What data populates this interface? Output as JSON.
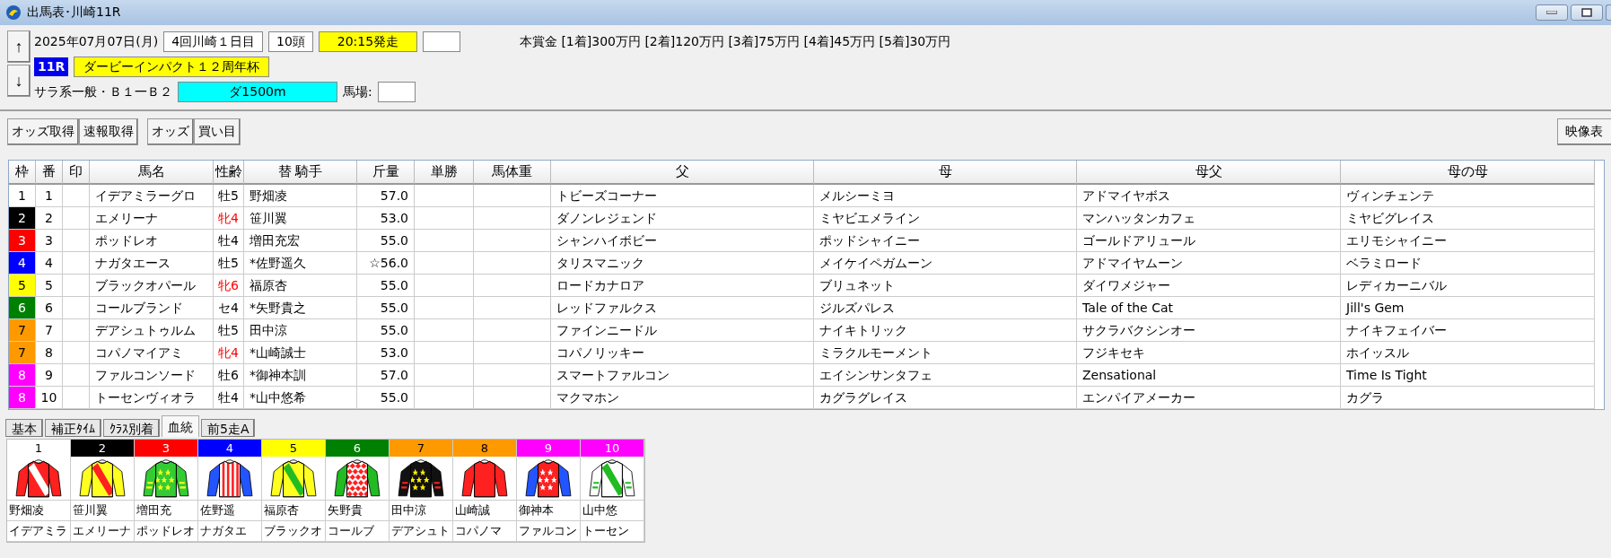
{
  "window": {
    "title": "出馬表･川崎11R"
  },
  "race": {
    "date": "2025年07月07日(月)",
    "meeting": "4回川崎１日目",
    "runners": "10頭",
    "post_time": "20:15発走",
    "race_number": "11R",
    "race_name": "ダービーインパクト１２周年杯",
    "class": "サラ系一般・Ｂ１一Ｂ２",
    "course": "ダ1500m",
    "going_label": "馬場:",
    "prize": "本賞金 [1着]300万円 [2着]120万円 [3着]75万円 [4着]45万円 [5着]30万円"
  },
  "nav_buttons": [
    "↑",
    "↓"
  ],
  "toolbar": [
    "オッズ取得",
    "速報取得",
    "オッズ",
    "買い目"
  ],
  "right_button": "映像表",
  "table": {
    "columns": [
      "枠",
      "番",
      "印",
      "馬名",
      "性齢",
      "替 騎手",
      "斤量",
      "単勝",
      "馬体重",
      "父",
      "母",
      "母父",
      "母の母"
    ],
    "rows": [
      {
        "frame": "1",
        "color": "#ffffff",
        "number": "1",
        "name": "イデアミラーグロ",
        "sex_age": "牡5",
        "filly": false,
        "jockey": "野畑凌",
        "weight": "57.0",
        "sire": "トビーズコーナー",
        "dam": "メルシーミヨ",
        "damsire": "アドマイヤボス",
        "dam_dam": "ヴィンチェンテ"
      },
      {
        "frame": "2",
        "color": "#000000",
        "number": "2",
        "name": "エメリーナ",
        "sex_age": "牝4",
        "filly": true,
        "jockey": "笹川翼",
        "weight": "53.0",
        "sire": "ダノンレジェンド",
        "dam": "ミヤビエメライン",
        "damsire": "マンハッタンカフェ",
        "dam_dam": "ミヤビグレイス"
      },
      {
        "frame": "3",
        "color": "#ff0000",
        "number": "3",
        "name": "ポッドレオ",
        "sex_age": "牡4",
        "filly": false,
        "jockey": "増田充宏",
        "weight": "55.0",
        "sire": "シャンハイボビー",
        "dam": "ポッドシャイニー",
        "damsire": "ゴールドアリュール",
        "dam_dam": "エリモシャイニー"
      },
      {
        "frame": "4",
        "color": "#0000ff",
        "number": "4",
        "name": "ナガタエース",
        "sex_age": "牡5",
        "filly": false,
        "jockey": "*佐野遥久",
        "weight": "☆56.0",
        "sire": "タリスマニック",
        "dam": "メイケイペガムーン",
        "damsire": "アドマイヤムーン",
        "dam_dam": "ベラミロード"
      },
      {
        "frame": "5",
        "color": "#ffff00",
        "number": "5",
        "name": "ブラックオパール",
        "sex_age": "牝6",
        "filly": true,
        "jockey": "福原杏",
        "weight": "55.0",
        "sire": "ロードカナロア",
        "dam": "ブリュネット",
        "damsire": "ダイワメジャー",
        "dam_dam": "レディカーニバル"
      },
      {
        "frame": "6",
        "color": "#008000",
        "number": "6",
        "name": "コールブランド",
        "sex_age": "セ4",
        "filly": false,
        "jockey": "*矢野貴之",
        "weight": "55.0",
        "sire": "レッドファルクス",
        "dam": "ジルズパレス",
        "damsire": "Tale of the Cat",
        "dam_dam": "Jill's Gem"
      },
      {
        "frame": "7",
        "color": "#ff9900",
        "number": "7",
        "name": "デアシュトゥルム",
        "sex_age": "牡5",
        "filly": false,
        "jockey": "田中涼",
        "weight": "55.0",
        "sire": "ファインニードル",
        "dam": "ナイキトリック",
        "damsire": "サクラバクシンオー",
        "dam_dam": "ナイキフェイバー"
      },
      {
        "frame": "7",
        "color": "#ff9900",
        "number": "8",
        "name": "コパノマイアミ",
        "sex_age": "牝4",
        "filly": true,
        "jockey": "*山崎誠士",
        "weight": "53.0",
        "sire": "コパノリッキー",
        "dam": "ミラクルモーメント",
        "damsire": "フジキセキ",
        "dam_dam": "ホイッスル"
      },
      {
        "frame": "8",
        "color": "#ff00ff",
        "number": "9",
        "name": "ファルコンソード",
        "sex_age": "牡6",
        "filly": false,
        "jockey": "*御神本訓",
        "weight": "57.0",
        "sire": "スマートファルコン",
        "dam": "エイシンサンタフェ",
        "damsire": "Zensational",
        "dam_dam": "Time Is Tight"
      },
      {
        "frame": "8",
        "color": "#ff00ff",
        "number": "10",
        "name": "トーセンヴィオラ",
        "sex_age": "牡4",
        "filly": false,
        "jockey": "*山中悠希",
        "weight": "55.0",
        "sire": "マクマホン",
        "dam": "カグラグレイス",
        "damsire": "エンパイアメーカー",
        "dam_dam": "カグラ"
      }
    ]
  },
  "tabs": [
    {
      "label": "基本",
      "selected": false
    },
    {
      "label": "補正ﾀｲﾑ",
      "selected": false
    },
    {
      "label": "ｸﾗｽ別着",
      "selected": false
    },
    {
      "label": "血統",
      "selected": true
    },
    {
      "label": "前5走A",
      "selected": false
    }
  ],
  "silks": [
    {
      "number": "1",
      "color": "#ffffff",
      "jockey": "野畑凌",
      "horse": "イデアミラ"
    },
    {
      "number": "2",
      "color": "#000000",
      "jockey": "笹川翼",
      "horse": "エメリーナ"
    },
    {
      "number": "3",
      "color": "#ff0000",
      "jockey": "増田充",
      "horse": "ポッドレオ"
    },
    {
      "number": "4",
      "color": "#0000ff",
      "jockey": "佐野遥",
      "horse": "ナガタエ"
    },
    {
      "number": "5",
      "color": "#ffff00",
      "jockey": "福原杏",
      "horse": "ブラックオ"
    },
    {
      "number": "6",
      "color": "#008000",
      "jockey": "矢野貴",
      "horse": "コールブ"
    },
    {
      "number": "7",
      "color": "#ff9900",
      "jockey": "田中涼",
      "horse": "デアシュト"
    },
    {
      "number": "8",
      "color": "#ff9900",
      "jockey": "山崎誠",
      "horse": "コパノマ"
    },
    {
      "number": "9",
      "color": "#ff00ff",
      "jockey": "御神本",
      "horse": "ファルコン"
    },
    {
      "number": "10",
      "color": "#ff00ff",
      "jockey": "山中悠",
      "horse": "トーセン"
    }
  ]
}
